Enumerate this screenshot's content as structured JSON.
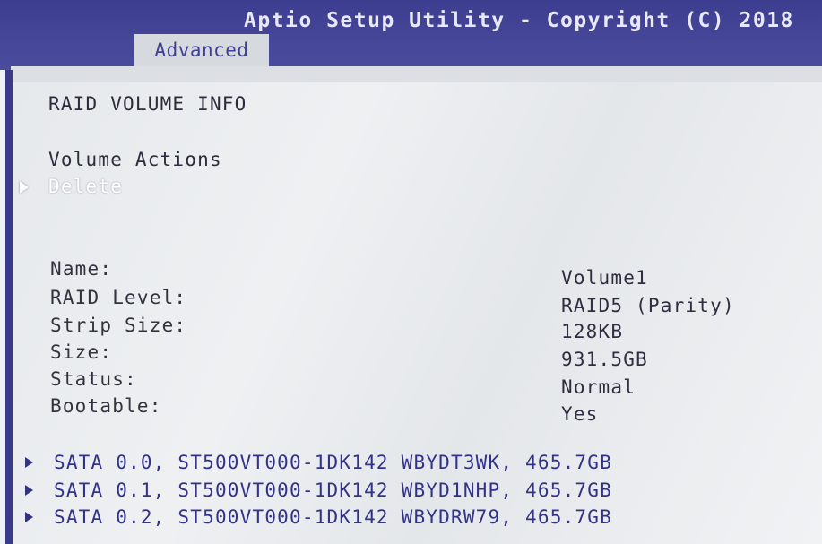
{
  "header": {
    "title": "Aptio Setup Utility - Copyright (C) 2018",
    "active_tab": "Advanced"
  },
  "page": {
    "section_title": "RAID VOLUME INFO",
    "actions_label": "Volume Actions",
    "delete_label": "Delete"
  },
  "volume": {
    "fields": [
      {
        "label": "Name:",
        "value": "Volume1"
      },
      {
        "label": "RAID Level:",
        "value": "RAID5 (Parity)"
      },
      {
        "label": "Strip Size:",
        "value": "128KB"
      },
      {
        "label": "Size:",
        "value": "931.5GB"
      },
      {
        "label": "Status:",
        "value": "Normal"
      },
      {
        "label": "Bootable:",
        "value": "Yes"
      }
    ]
  },
  "disks": [
    "SATA 0.0, ST500VT000-1DK142 WBYDT3WK, 465.7GB",
    "SATA 0.1, ST500VT000-1DK142 WBYD1NHP, 465.7GB",
    "SATA 0.2, ST500VT000-1DK142 WBYDRW79, 465.7GB"
  ],
  "colors": {
    "header_bg": "#474799",
    "tab_bg": "#d6d9de",
    "tab_text": "#3f3f93",
    "panel_bg": "#eceff2",
    "selected_text": "#ffffff",
    "submenu_text": "#323288"
  }
}
